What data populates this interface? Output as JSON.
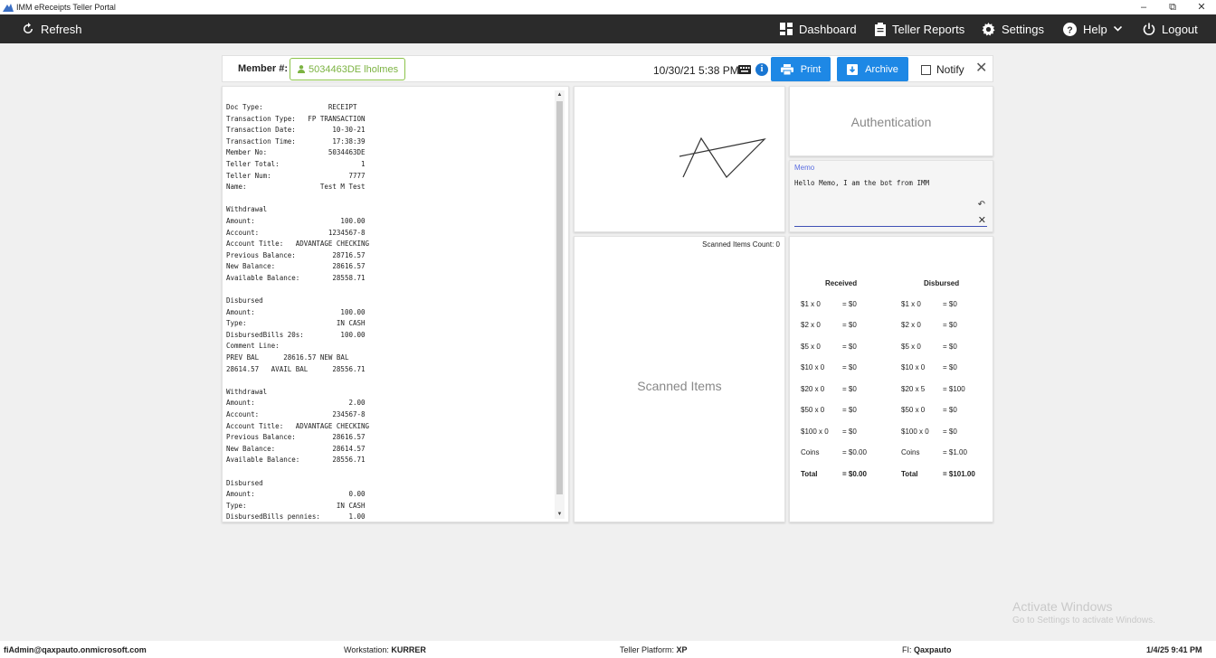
{
  "window": {
    "title": "IMM eReceipts Teller Portal"
  },
  "nav": {
    "refresh": "Refresh",
    "dashboard": "Dashboard",
    "teller_reports": "Teller Reports",
    "settings": "Settings",
    "help": "Help",
    "logout": "Logout"
  },
  "toolbar": {
    "member_label": "Member #:",
    "member_value": "5034463DE lholmes",
    "datetime": "10/30/21 5:38 PM",
    "print": "Print",
    "archive": "Archive",
    "notify": "Notify"
  },
  "receipt": {
    "text": "Doc Type:                RECEIPT\nTransaction Type:   FP TRANSACTION\nTransaction Date:         10-30-21\nTransaction Time:         17:38:39\nMember No:               5034463DE\nTeller Total:                    1\nTeller Num:                   7777\nName:                  Test M Test\n\nWithdrawal\nAmount:                     100.00\nAccount:                 1234567-8\nAccount Title:   ADVANTAGE CHECKING\nPrevious Balance:         28716.57\nNew Balance:              28616.57\nAvailable Balance:        28558.71\n\nDisbursed\nAmount:                     100.00\nType:                      IN CASH\nDisbursedBills 20s:         100.00\nComment Line:\nPREV BAL      28616.57 NEW BAL\n28614.57   AVAIL BAL      28556.71\n\nWithdrawal\nAmount:                       2.00\nAccount:                  234567-8\nAccount Title:   ADVANTAGE CHECKING\nPrevious Balance:         28616.57\nNew Balance:              28614.57\nAvailable Balance:        28556.71\n\nDisbursed\nAmount:                       0.00\nType:                      IN CASH\nDisbursedBills pennies:       1.00"
  },
  "authentication": {
    "label": "Authentication"
  },
  "memo": {
    "label": "Memo",
    "text": "Hello Memo, I am the bot from IMM"
  },
  "scanned": {
    "count_label": "Scanned Items Count: 0",
    "label": "Scanned Items"
  },
  "cash": {
    "received_header": "Received",
    "disbursed_header": "Disbursed",
    "received": [
      {
        "denom": "$1 x 0",
        "total": "= $0"
      },
      {
        "denom": "$2 x 0",
        "total": "= $0"
      },
      {
        "denom": "$5 x 0",
        "total": "= $0"
      },
      {
        "denom": "$10 x 0",
        "total": "= $0"
      },
      {
        "denom": "$20 x 0",
        "total": "= $0"
      },
      {
        "denom": "$50 x 0",
        "total": "= $0"
      },
      {
        "denom": "$100 x 0",
        "total": "= $0"
      },
      {
        "denom": "Coins",
        "total": "= $0.00"
      },
      {
        "denom": "Total",
        "total": "= $0.00"
      }
    ],
    "disbursed": [
      {
        "denom": "$1 x 0",
        "total": "= $0"
      },
      {
        "denom": "$2 x 0",
        "total": "= $0"
      },
      {
        "denom": "$5 x 0",
        "total": "= $0"
      },
      {
        "denom": "$10 x 0",
        "total": "= $0"
      },
      {
        "denom": "$20 x 5",
        "total": "= $100"
      },
      {
        "denom": "$50 x 0",
        "total": "= $0"
      },
      {
        "denom": "$100 x 0",
        "total": "= $0"
      },
      {
        "denom": "Coins",
        "total": "= $1.00"
      },
      {
        "denom": "Total",
        "total": "= $101.00"
      }
    ]
  },
  "watermark": {
    "line1": "Activate Windows",
    "line2": "Go to Settings to activate Windows."
  },
  "status": {
    "user": "fiAdmin@qaxpauto.onmicrosoft.com",
    "workstation_label": "Workstation:",
    "workstation": "KURRER",
    "platform_label": "Teller Platform:",
    "platform": "XP",
    "fi_label": "FI:",
    "fi": "Qaxpauto",
    "datetime": "1/4/25 9:41 PM"
  },
  "colors": {
    "nav_bg": "#2b2b2b",
    "primary_button": "#1e88e5",
    "member_chip": "#7cb342",
    "memo_underline": "#3f51b5"
  }
}
